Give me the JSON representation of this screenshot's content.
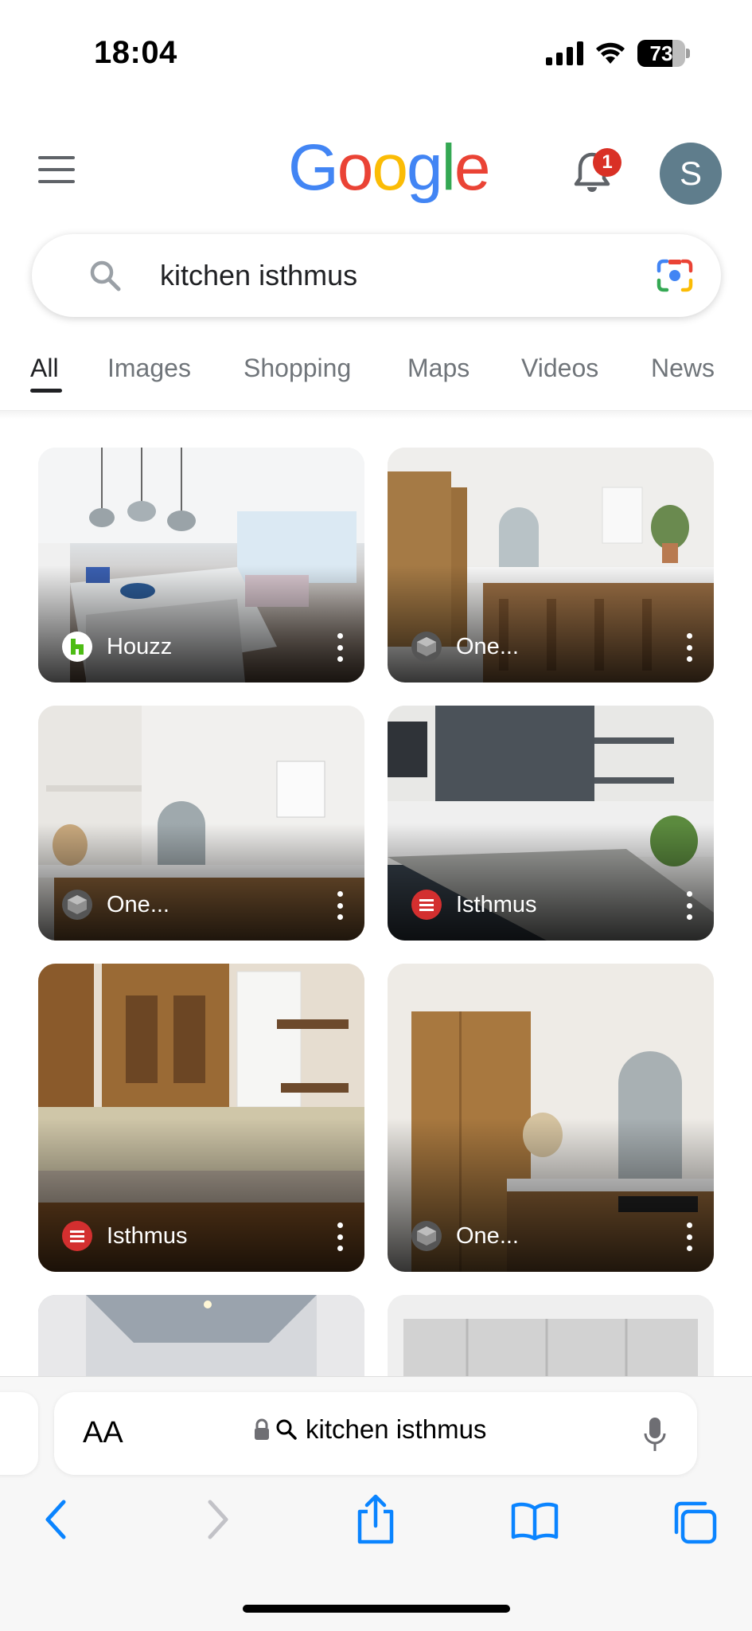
{
  "status_bar": {
    "time": "18:04",
    "battery": "73",
    "battery_level": 0.73
  },
  "header": {
    "logo_letters": [
      "G",
      "o",
      "o",
      "g",
      "l",
      "e"
    ],
    "notification_count": "1",
    "avatar_initial": "S"
  },
  "search": {
    "query": "kitchen isthmus"
  },
  "tabs": [
    {
      "label": "All",
      "active": true
    },
    {
      "label": "Images",
      "active": false
    },
    {
      "label": "Shopping",
      "active": false
    },
    {
      "label": "Maps",
      "active": false
    },
    {
      "label": "Videos",
      "active": false
    },
    {
      "label": "News",
      "active": false
    }
  ],
  "results": [
    {
      "source": "Houzz",
      "logo_color": "#ffffff"
    },
    {
      "source": "One...",
      "logo_color": "#555555"
    },
    {
      "source": "One...",
      "logo_color": "#555555"
    },
    {
      "source": "Isthmus",
      "logo_color": "#d32f2f"
    },
    {
      "source": "Isthmus",
      "logo_color": "#d32f2f"
    },
    {
      "source": "One...",
      "logo_color": "#555555"
    }
  ],
  "browser": {
    "text_size_label": "AA",
    "url_text": "kitchen isthmus"
  },
  "colors": {
    "accent": "#1a73e8",
    "safari_blue": "#0a84ff",
    "badge_red": "#d93025"
  }
}
